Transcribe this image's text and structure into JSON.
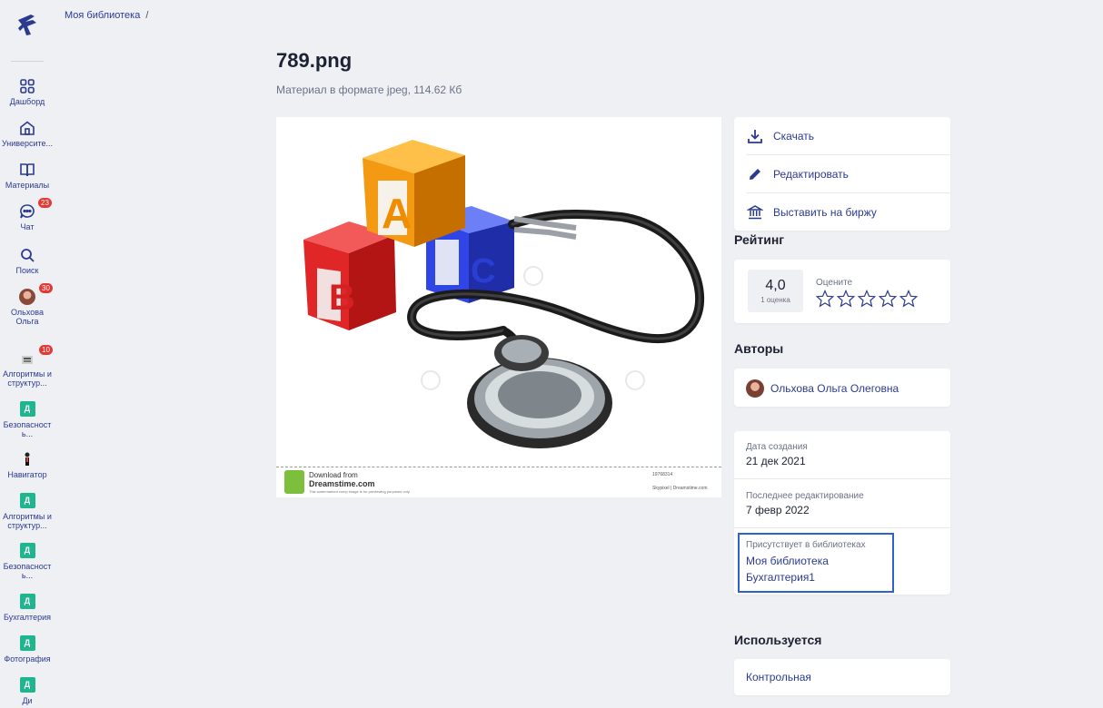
{
  "breadcrumb": {
    "root": "Моя библиотека",
    "separator": "/"
  },
  "title": "789.png",
  "subtitle": "Материал в формате jpeg, 114.62 Кб",
  "sidebar": {
    "items": [
      {
        "label": "Дашборд",
        "icon": "grid-icon"
      },
      {
        "label": "Университе...",
        "icon": "home-icon"
      },
      {
        "label": "Материалы",
        "icon": "book-icon"
      },
      {
        "label": "Чат",
        "icon": "chat-icon",
        "badge": "23"
      },
      {
        "label": "Поиск",
        "icon": "search-icon"
      },
      {
        "label": "Ольхова Ольга",
        "icon": "avatar",
        "badge": "30"
      },
      {
        "label": "Алгоритмы и структур...",
        "icon": "group-avatar",
        "badge": "10"
      },
      {
        "label": "Безопасност ь...",
        "icon": "d-square",
        "letter": "Д"
      },
      {
        "label": "Навигатор",
        "icon": "navigator-avatar"
      },
      {
        "label": "Алгоритмы и структур...",
        "icon": "d-square",
        "letter": "Д"
      },
      {
        "label": "Безопасност ь...",
        "icon": "d-square",
        "letter": "Д"
      },
      {
        "label": "Бухгалтерия",
        "icon": "d-square",
        "letter": "Д"
      },
      {
        "label": "Фотография",
        "icon": "d-square",
        "letter": "Д"
      },
      {
        "label": "Ди",
        "icon": "d-square",
        "letter": "Д"
      }
    ]
  },
  "preview": {
    "strip_t1": "Download from",
    "strip_t2": "Dreamstime.com",
    "strip_t3": "This watermarked comp image is for previewing purposes only.",
    "strip_r1": "19768314",
    "strip_r2": "Skypixel | Dreamstime.com"
  },
  "actions": {
    "download": "Скачать",
    "edit": "Редактировать",
    "exchange": "Выставить на биржу"
  },
  "rating": {
    "heading": "Рейтинг",
    "value": "4,0",
    "count": "1 оценка",
    "rate_label": "Оцените",
    "stars_total": 5
  },
  "authors": {
    "heading": "Авторы",
    "name": "Ольхова Ольга Олеговна"
  },
  "meta": {
    "created_label": "Дата создания",
    "created_value": "21 дек 2021",
    "edited_label": "Последнее редактирование",
    "edited_value": "7 февр 2022",
    "libs_label": "Присутствует в библиотеках",
    "libs": [
      "Моя библиотека",
      "Бухгалтерия1"
    ]
  },
  "used": {
    "heading": "Используется",
    "item": "Контрольная"
  },
  "colors": {
    "accent": "#2b3a8f",
    "badge": "#e53935",
    "d_square": "#1fb58f",
    "highlight": "#2b63c8"
  }
}
